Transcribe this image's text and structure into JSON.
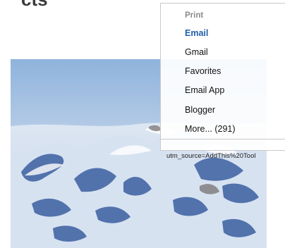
{
  "page": {
    "heading": "cts"
  },
  "share_menu": {
    "items": [
      {
        "label": "Print"
      },
      {
        "label": "Email"
      },
      {
        "label": "Gmail"
      },
      {
        "label": "Favorites"
      },
      {
        "label": "Email App"
      },
      {
        "label": "Blogger"
      },
      {
        "label": "More... (291)"
      }
    ]
  },
  "tracking_text": "utm_source=AddThis%20Tool",
  "colors": {
    "active_item": "#1f5fa8",
    "muted_item": "#8a8a8a",
    "menu_border": "#c9c9c9"
  }
}
